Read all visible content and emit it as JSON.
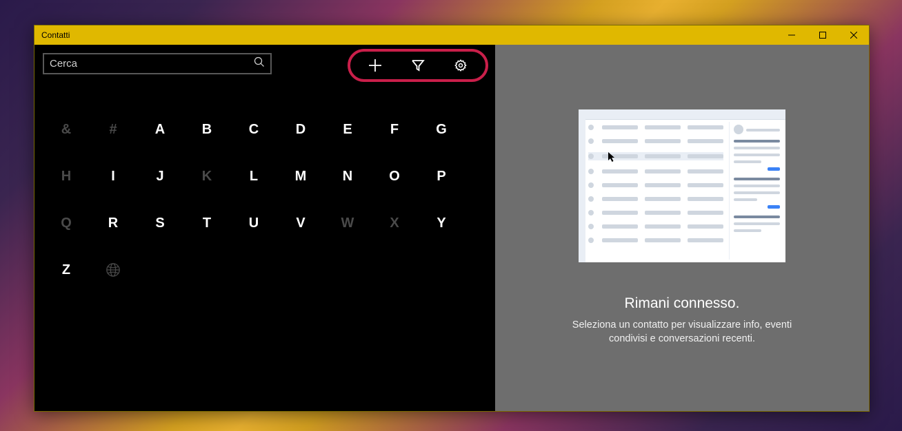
{
  "window": {
    "title": "Contatti"
  },
  "search": {
    "placeholder": "Cerca",
    "value": ""
  },
  "toolbar": {
    "add": "plus-icon",
    "filter": "filter-icon",
    "settings": "gear-icon"
  },
  "alpha_index": [
    {
      "label": "&",
      "enabled": false
    },
    {
      "label": "#",
      "enabled": false
    },
    {
      "label": "A",
      "enabled": true
    },
    {
      "label": "B",
      "enabled": true
    },
    {
      "label": "C",
      "enabled": true
    },
    {
      "label": "D",
      "enabled": true
    },
    {
      "label": "E",
      "enabled": true
    },
    {
      "label": "F",
      "enabled": true
    },
    {
      "label": "G",
      "enabled": true
    },
    {
      "label": "H",
      "enabled": false
    },
    {
      "label": "I",
      "enabled": true
    },
    {
      "label": "J",
      "enabled": true
    },
    {
      "label": "K",
      "enabled": false
    },
    {
      "label": "L",
      "enabled": true
    },
    {
      "label": "M",
      "enabled": true
    },
    {
      "label": "N",
      "enabled": true
    },
    {
      "label": "O",
      "enabled": true
    },
    {
      "label": "P",
      "enabled": true
    },
    {
      "label": "Q",
      "enabled": false
    },
    {
      "label": "R",
      "enabled": true
    },
    {
      "label": "S",
      "enabled": true
    },
    {
      "label": "T",
      "enabled": true
    },
    {
      "label": "U",
      "enabled": true
    },
    {
      "label": "V",
      "enabled": true
    },
    {
      "label": "W",
      "enabled": false
    },
    {
      "label": "X",
      "enabled": false
    },
    {
      "label": "Y",
      "enabled": true
    },
    {
      "label": "Z",
      "enabled": true
    },
    {
      "label": "globe",
      "enabled": false,
      "icon": true
    }
  ],
  "empty_state": {
    "title": "Rimani connesso.",
    "description": "Seleziona un contatto per visualizzare info, eventi condivisi e conversazioni recenti."
  }
}
